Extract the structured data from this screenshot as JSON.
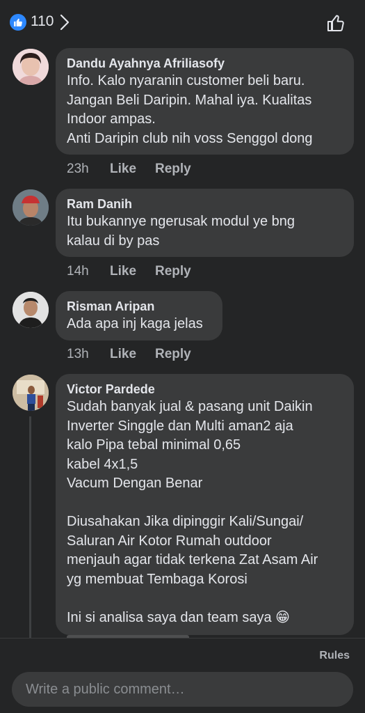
{
  "reactions": {
    "count": "110",
    "icon": "thumbs-up-icon",
    "color": "#2d88ff"
  },
  "comments": [
    {
      "author": "Dandu Ayahnya Afriliasofy",
      "text": "Info.  Kalo nyaranin customer beli baru.\nJangan Beli Daripin. Mahal iya. Kualitas\nIndoor ampas.\nAnti Daripin club nih voss Senggol dong",
      "time": "23h",
      "like": "Like",
      "reply": "Reply"
    },
    {
      "author": "Ram Danih",
      "text": "Itu bukannye ngerusak modul ye bng\nkalau di by pas",
      "time": "14h",
      "like": "Like",
      "reply": "Reply"
    },
    {
      "author": "Risman Aripan",
      "text": "Ada apa inj kaga jelas",
      "time": "13h",
      "like": "Like",
      "reply": "Reply"
    },
    {
      "author": "Victor Pardede",
      "text": "Sudah banyak jual & pasang unit Daikin\nInverter Singgle dan Multi aman2 aja\nkalo Pipa tebal minimal 0,65\nkabel 4x1,5\nVacum Dengan Benar\n\nDiusahakan Jika dipinggir Kali/Sungai/\nSaluran Air Kotor Rumah outdoor\nmenjauh agar tidak terkena Zat Asam Air\nyg membuat Tembaga Korosi\n\nIni si analisa saya dan team saya 😁"
    }
  ],
  "footer": {
    "rules": "Rules",
    "placeholder": "Write a public comment…"
  }
}
